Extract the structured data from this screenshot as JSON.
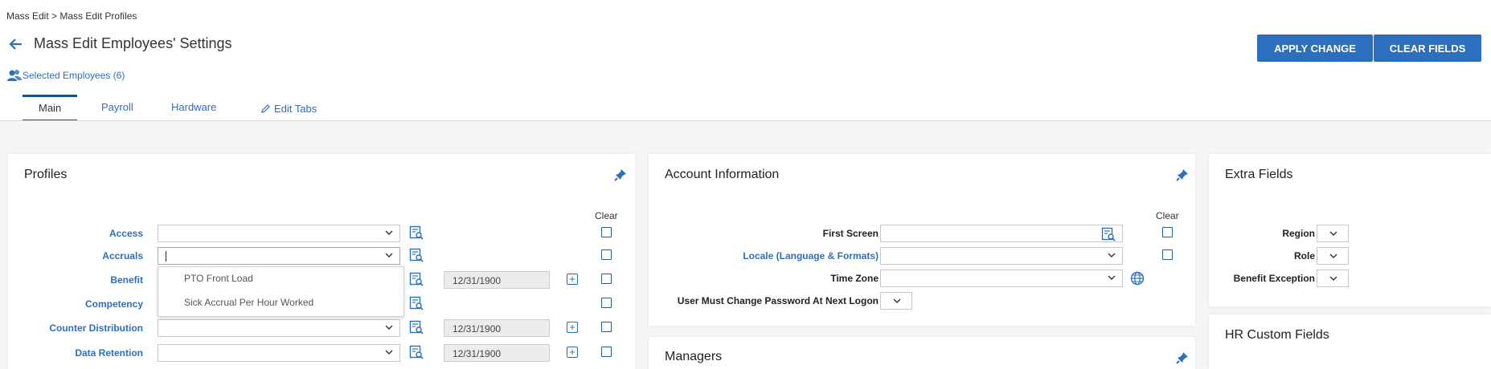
{
  "breadcrumb": {
    "item1": "Mass Edit",
    "sep": ">",
    "item2": "Mass Edit Profiles"
  },
  "header": {
    "title": "Mass Edit Employees' Settings",
    "apply_label": "APPLY CHANGE",
    "clear_label": "CLEAR FIELDS"
  },
  "selected_employees": "Selected Employees (6)",
  "tabs": [
    {
      "label": "Main"
    },
    {
      "label": "Payroll"
    },
    {
      "label": "Hardware"
    },
    {
      "label": "Edit Tabs"
    }
  ],
  "profiles": {
    "title": "Profiles",
    "clear_header": "Clear",
    "rows": [
      {
        "label": "Access"
      },
      {
        "label": "Accruals"
      },
      {
        "label": "Benefit",
        "date": "12/31/1900"
      },
      {
        "label": "Competency"
      },
      {
        "label": "Counter Distribution",
        "date": "12/31/1900"
      },
      {
        "label": "Data Retention",
        "date": "12/31/1900"
      }
    ],
    "dropdown_options": [
      "PTO Front Load",
      "Sick Accrual Per Hour Worked"
    ]
  },
  "account": {
    "title": "Account Information",
    "clear_header": "Clear",
    "rows": [
      {
        "label": "First Screen"
      },
      {
        "label": "Locale (Language & Formats)"
      },
      {
        "label": "Time Zone"
      },
      {
        "label": "User Must Change Password At Next Logon"
      }
    ]
  },
  "managers": {
    "title": "Managers"
  },
  "extra": {
    "title": "Extra Fields",
    "rows": [
      {
        "label": "Region"
      },
      {
        "label": "Role"
      },
      {
        "label": "Benefit Exception"
      }
    ]
  },
  "hr_custom": {
    "title": "HR Custom Fields"
  },
  "colors": {
    "accent": "#2c6fbf",
    "button_bg": "#2c6fbf",
    "tab_active": "#1f4e8c"
  },
  "icons": [
    "back-arrow-icon",
    "users-icon",
    "pencil-icon",
    "pin-icon",
    "lookup-icon",
    "chevron-down-icon",
    "plus-icon",
    "globe-icon"
  ]
}
